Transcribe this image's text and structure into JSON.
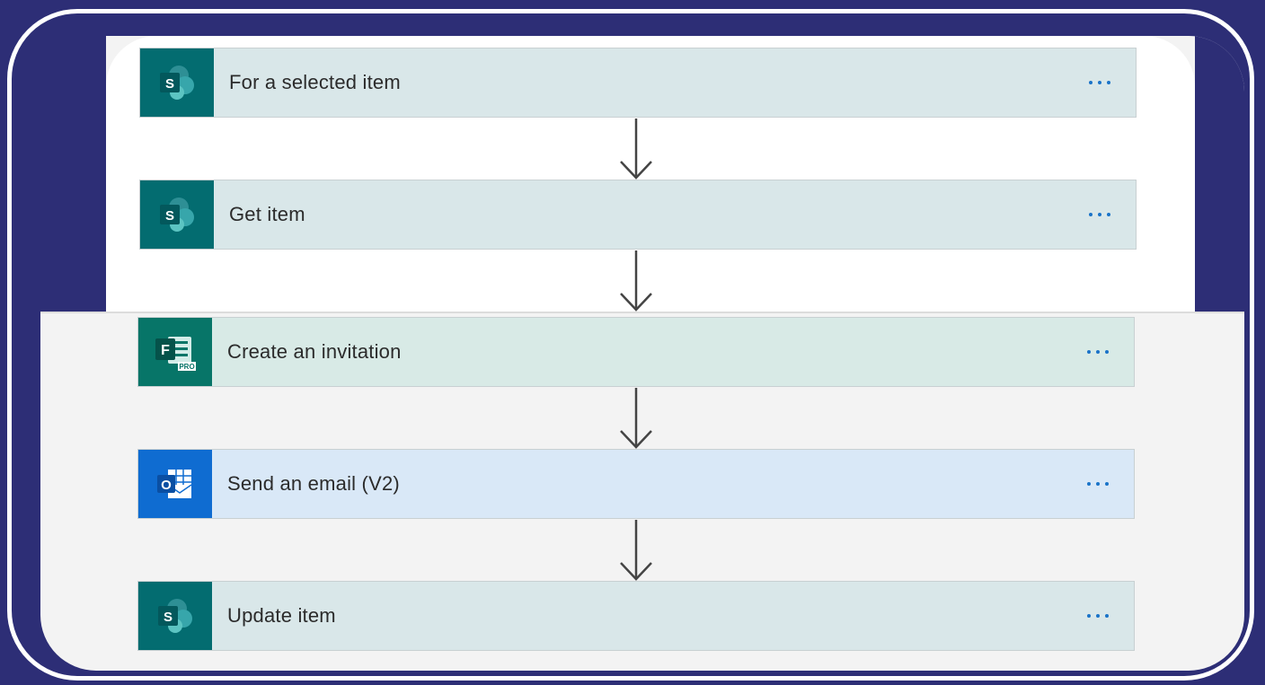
{
  "flow": {
    "steps": [
      {
        "title": "For a selected item",
        "connector": "SharePoint",
        "icon": "sharepoint-icon",
        "color": "#036c70",
        "card_bg": "#d9e7e9"
      },
      {
        "title": "Get item",
        "connector": "SharePoint",
        "icon": "sharepoint-icon",
        "color": "#036c70",
        "card_bg": "#d9e7e9"
      },
      {
        "title": "Create an invitation",
        "connector": "Microsoft Forms Pro",
        "icon": "forms-pro-icon",
        "color": "#077568",
        "card_bg": "#d8eae6",
        "badge": "PRO"
      },
      {
        "title": "Send an email (V2)",
        "connector": "Outlook",
        "icon": "outlook-icon",
        "color": "#0f6cd1",
        "card_bg": "#d9e8f7"
      },
      {
        "title": "Update item",
        "connector": "SharePoint",
        "icon": "sharepoint-icon",
        "color": "#036c70",
        "card_bg": "#d9e7e9"
      }
    ],
    "menu_icon": "ellipsis-icon",
    "connector_icon": "arrow-down-icon",
    "colors": {
      "background": "#2d2e76",
      "frame": "#ffffff",
      "canvas": "#f3f3f3",
      "menu_dots": "#1a73c8"
    }
  }
}
